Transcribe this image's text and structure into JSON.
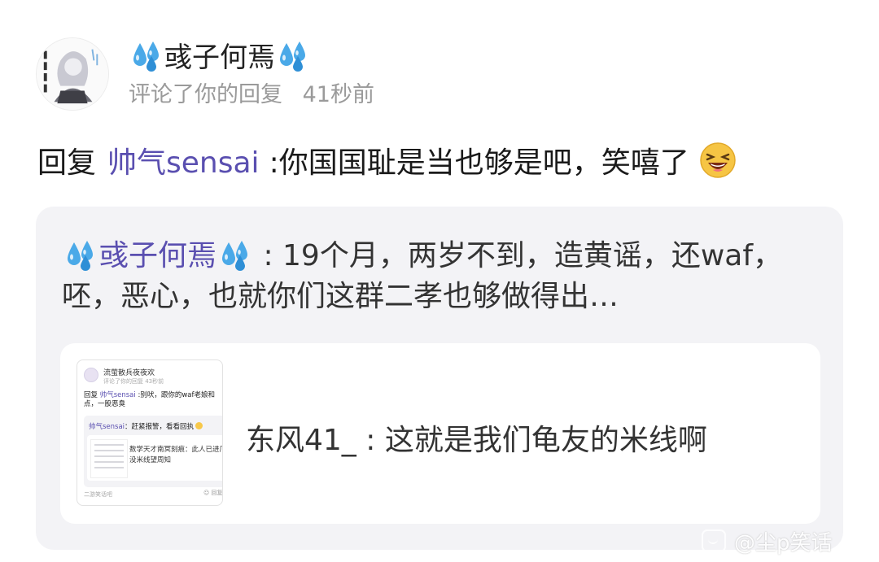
{
  "comment": {
    "author": "彧子何焉",
    "action": "评论了你的回复",
    "time": "41秒前",
    "reply_prefix": "回复",
    "reply_mention": "帅气sensai",
    "reply_text": ":你国国耻是当也够是吧，笑嘻了",
    "emoji": "laughing-face"
  },
  "quote": {
    "author": "彧子何焉",
    "text": " : 19个月，两岁不到，造黄谣，还waf，呸，恶心，也就你们这群二孝也够做得出…"
  },
  "card": {
    "text": "东风41_ : 这就是我们龟友的米线啊",
    "thumb": {
      "name": "流萤散兵夜夜欢",
      "sub": "评论了你的回复 43秒前",
      "reply_prefix": "回复 ",
      "reply_mention": "帅气sensai",
      "reply_text_1": " :别吠，跟你的waf老娘和",
      "reply_text_2": "点，一股恶臭",
      "quote_mention": "帅气sensai",
      "quote_text": "：赶紧报警，看看回执",
      "inner_text": "数学天才南冥刻痕：此人已进厂由没米线望周知",
      "footer_left": "二游笑话吧",
      "footer_right": "回复"
    }
  },
  "watermark": {
    "text": "@尘p笑话"
  },
  "colors": {
    "mention": "#5a4fb0",
    "quote_bg": "#f3f3f6",
    "drop": "#4aa9e8"
  }
}
